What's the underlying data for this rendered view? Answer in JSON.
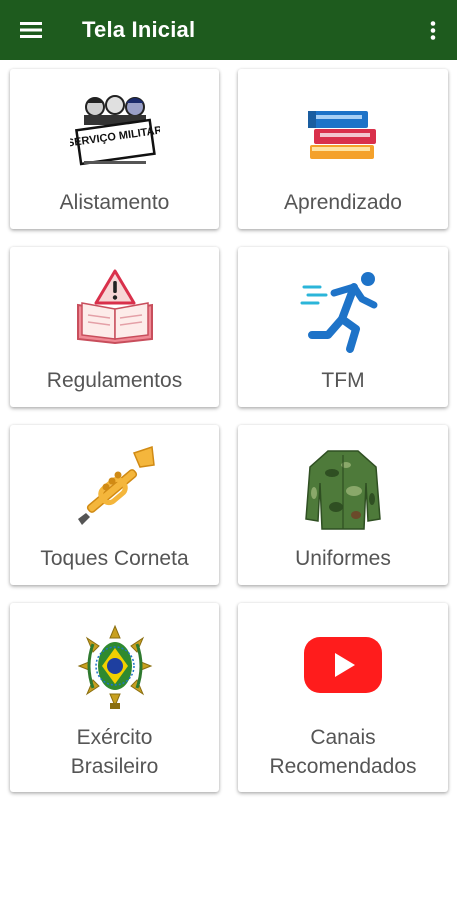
{
  "appbar": {
    "title": "Tela Inicial",
    "menu_icon": "hamburger-menu-icon",
    "overflow_icon": "more-vert-icon",
    "color": "#1e5b1e"
  },
  "cards": [
    {
      "label": "Alistamento",
      "icon": "servico-militar-logo-icon",
      "logo_text": "SERVIÇO MILITAR"
    },
    {
      "label": "Aprendizado",
      "icon": "books-stack-icon"
    },
    {
      "label": "Regulamentos",
      "icon": "open-book-warning-icon"
    },
    {
      "label": "TFM",
      "icon": "running-person-icon"
    },
    {
      "label": "Toques Corneta",
      "icon": "trumpet-icon"
    },
    {
      "label": "Uniformes",
      "icon": "camouflage-jacket-icon"
    },
    {
      "label": "Exército\nBrasileiro",
      "icon": "army-emblem-icon"
    },
    {
      "label": "Canais\nRecomendados",
      "icon": "youtube-play-icon"
    }
  ]
}
